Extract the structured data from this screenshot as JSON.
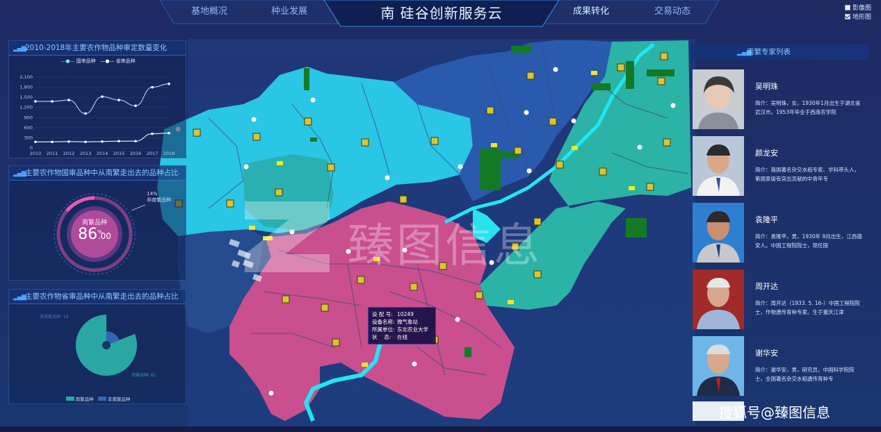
{
  "nav": {
    "items": [
      "基地概况",
      "种业发展",
      "成果转化",
      "交易动态"
    ],
    "active_index": 2,
    "title": "南 硅谷创新服务云"
  },
  "layer_toggle": [
    {
      "label": "影像图",
      "checked": false
    },
    {
      "label": "地形图",
      "checked": true
    }
  ],
  "panel1": {
    "title": "2010-2018年主要农作物品种审定数量变化",
    "legend": [
      "国审品种",
      "省审品种"
    ],
    "chart_data": {
      "type": "line",
      "x": [
        "2010",
        "2011",
        "2012",
        "2013",
        "2014",
        "2015",
        "2016",
        "2017",
        "2018"
      ],
      "series": [
        {
          "name": "国审品种",
          "values": [
            1380,
            1380,
            1420,
            1020,
            1520,
            1420,
            1250,
            1800,
            1900
          ]
        },
        {
          "name": "省审品种",
          "values": [
            180,
            180,
            190,
            180,
            190,
            200,
            200,
            420,
            440
          ]
        }
      ],
      "yticks": [
        "2,100",
        "1,800",
        "1,500",
        "1,200",
        "900",
        "600",
        "300",
        "0"
      ],
      "ylim": [
        0,
        2100
      ]
    }
  },
  "panel2": {
    "title": "主要农作物国审品种中从南繁走出去的品种占比",
    "label_top": "14%",
    "label_top_sub": "非南繁品种",
    "center_label": "南繁品种",
    "center_value": "86",
    "center_decimal": ".00",
    "center_unit": "%",
    "chart_data": {
      "type": "pie",
      "labels": [
        "南繁品种",
        "非南繁品种"
      ],
      "values": [
        86,
        14
      ]
    }
  },
  "panel3": {
    "title": "主要农作物省审品种中从南繁走出去的品种占比",
    "label_a": "非南繁品种: 19",
    "label_b": "南繁品种: 81",
    "legend": [
      "南繁品种",
      "非南繁品种"
    ],
    "chart_data": {
      "type": "pie",
      "labels": [
        "南繁品种",
        "非南繁品种"
      ],
      "values": [
        81,
        19
      ]
    }
  },
  "experts": {
    "title": "南繁专家列表",
    "list": [
      {
        "name": "吴明珠",
        "bio": "简介：吴明珠，女，1930年1月出生于湖北省武汉市。1953年毕业于西南农学院"
      },
      {
        "name": "颜龙安",
        "bio": "简介：我国著名杂交水稻专家、学科带头人，第国家级有突出贡献的中青年专"
      },
      {
        "name": "袁隆平",
        "bio": "简介：袁隆平，男，1930年 9月出生，江西德安人。中国工程院院士，现任国"
      },
      {
        "name": "周开达",
        "bio": "简介：周开达（1933. 5. 16-）中国工程院院士，作物遗传育种专家。生于重庆江津"
      },
      {
        "name": "谢华安",
        "bio": "简介：谢华安，男，研究员，中国科学院院士，全国著名杂交水稻遗传育种专"
      }
    ]
  },
  "tooltip": {
    "rows": [
      {
        "k": "设 配 号:",
        "v": "10249"
      },
      {
        "k": "设备名称:",
        "v": "微气象站"
      },
      {
        "k": "所属单位:",
        "v": "东北农业大学"
      },
      {
        "k": "状　 态:",
        "v": "在线"
      }
    ]
  },
  "watermark": "搜狐号@臻图信息",
  "brand_watermark": "臻图信息",
  "colors": {
    "cyan": "#29c6e6",
    "teal": "#2bb3a6",
    "blue": "#2a63b5",
    "pink": "#c94f8e",
    "river": "#22e6f2"
  }
}
